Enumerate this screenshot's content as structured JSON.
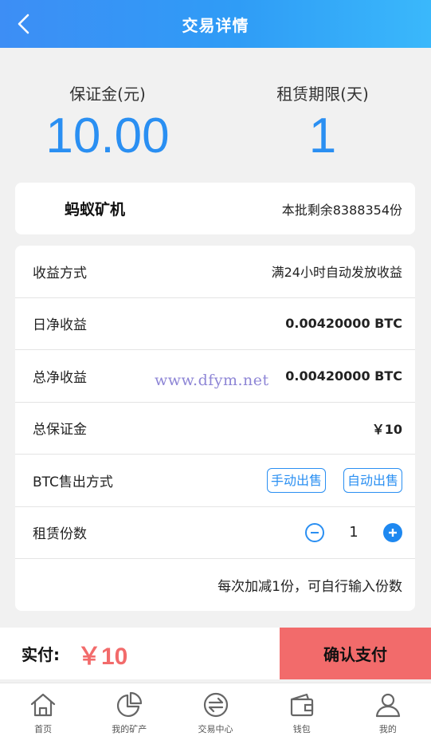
{
  "header": {
    "title": "交易详情"
  },
  "stats": {
    "deposit_label": "保证金(元)",
    "deposit_value": "10.00",
    "period_label": "租赁期限(天)",
    "period_value": "1"
  },
  "product": {
    "name": "蚂蚁矿机",
    "remaining": "本批剩余8388354份"
  },
  "details": {
    "income_method_label": "收益方式",
    "income_method_value": "满24小时自动发放收益",
    "daily_income_label": "日净收益",
    "daily_income_value": "0.00420000 BTC",
    "total_income_label": "总净收益",
    "total_income_value": "0.00420000 BTC",
    "total_deposit_label": "总保证金",
    "total_deposit_value": "￥10",
    "sell_method_label": "BTC售出方式",
    "sell_manual": "手动出售",
    "sell_auto": "自动出售",
    "quantity_label": "租赁份数",
    "quantity_value": "1",
    "hint": "每次加减1份，可自行输入份数"
  },
  "watermark": "www.dfym.net",
  "paybar": {
    "label": "实付:",
    "amount": "￥10",
    "confirm": "确认支付"
  },
  "tabs": [
    {
      "label": "首页",
      "icon": "home-icon"
    },
    {
      "label": "我的矿产",
      "icon": "pie-chart-icon"
    },
    {
      "label": "交易中心",
      "icon": "exchange-icon"
    },
    {
      "label": "钱包",
      "icon": "wallet-icon"
    },
    {
      "label": "我的",
      "icon": "user-icon"
    }
  ],
  "colors": {
    "accent": "#2a8ff2",
    "pay": "#f26b6b",
    "header_start": "#3d8ef5",
    "header_end": "#3ab8fb"
  }
}
